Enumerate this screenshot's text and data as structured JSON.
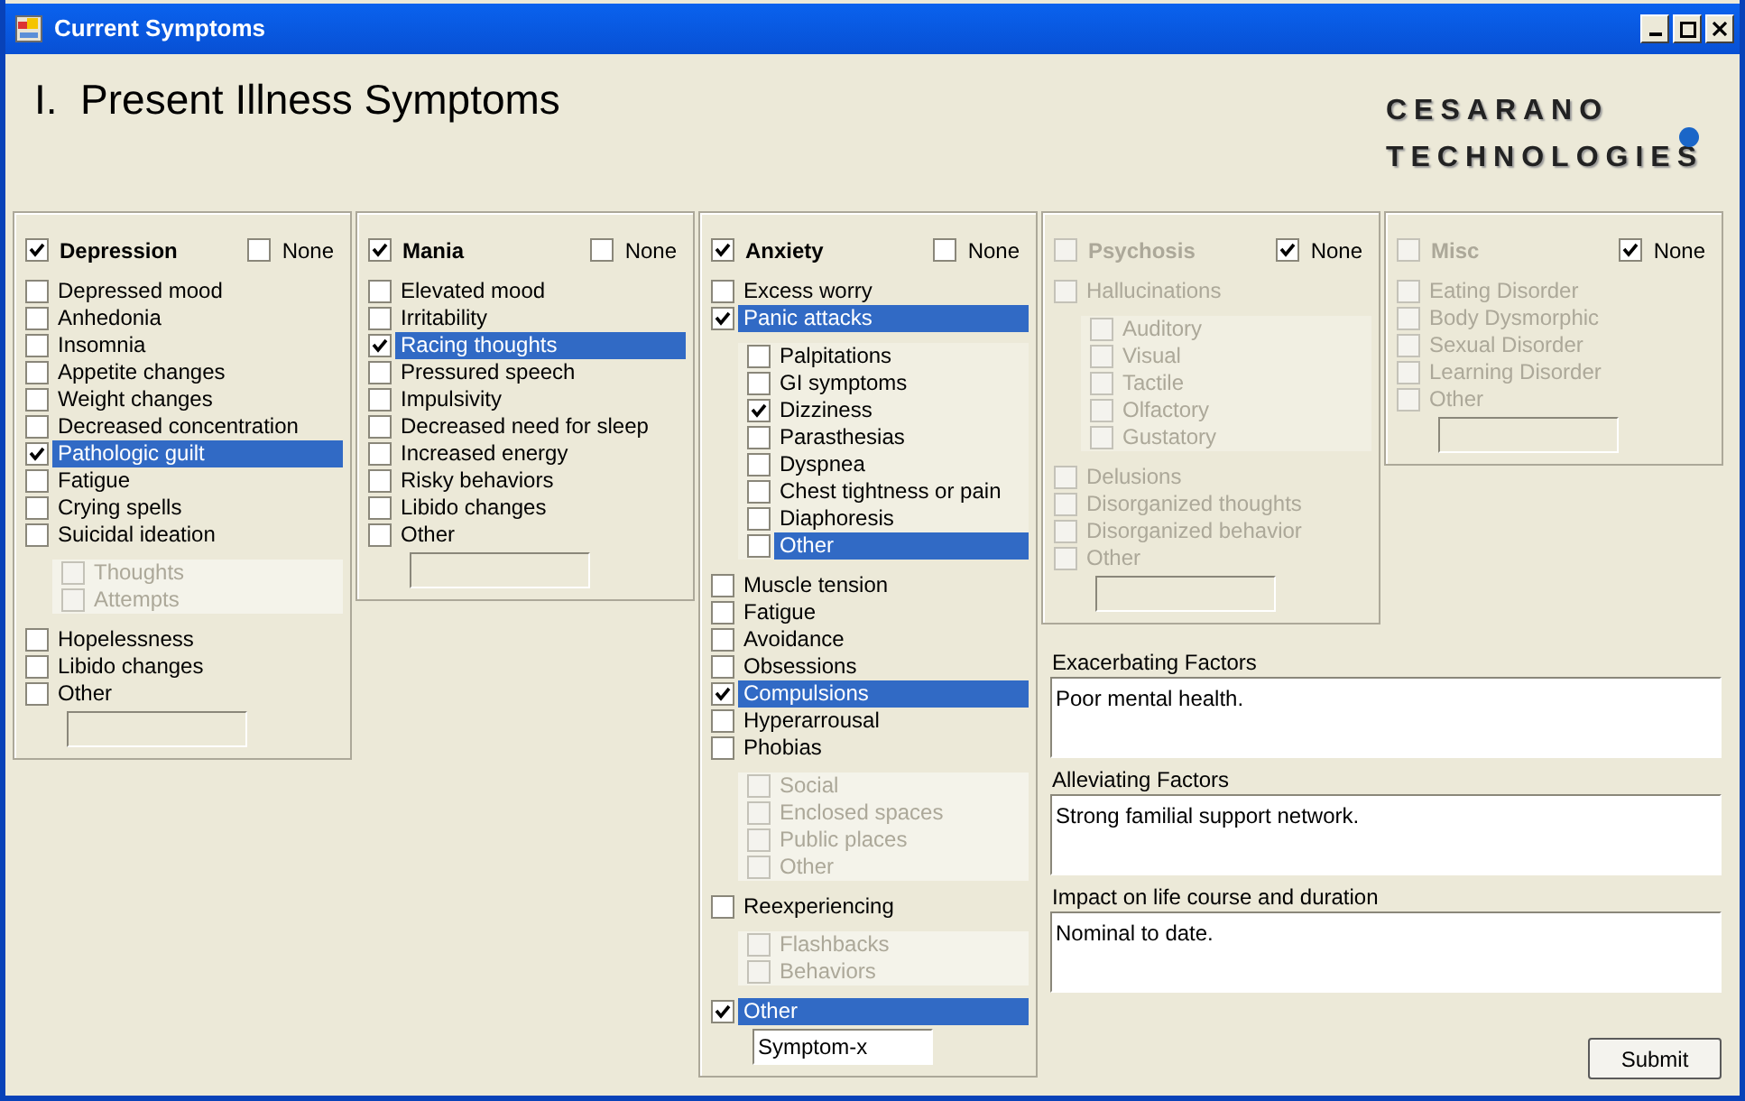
{
  "window": {
    "title": "Current Symptoms"
  },
  "heading": "I.  Present Illness Symptoms",
  "logo": [
    "CESARANO",
    "TECHNOLOGIES"
  ],
  "panels": [
    {
      "title": "Depression",
      "checked": true,
      "disabled": false,
      "none_label": "None",
      "none": false,
      "items": [
        {
          "kind": "check",
          "label": "Depressed mood",
          "checked": false,
          "selected": false
        },
        {
          "kind": "check",
          "label": "Anhedonia",
          "checked": false,
          "selected": false
        },
        {
          "kind": "check",
          "label": "Insomnia",
          "checked": false,
          "selected": false
        },
        {
          "kind": "check",
          "label": "Appetite changes",
          "checked": false,
          "selected": false
        },
        {
          "kind": "check",
          "label": "Weight changes",
          "checked": false,
          "selected": false
        },
        {
          "kind": "check",
          "label": "Decreased concentration",
          "checked": false,
          "selected": false
        },
        {
          "kind": "check",
          "label": "Pathologic guilt",
          "checked": true,
          "selected": true
        },
        {
          "kind": "check",
          "label": "Fatigue",
          "checked": false,
          "selected": false
        },
        {
          "kind": "check",
          "label": "Crying spells",
          "checked": false,
          "selected": false
        },
        {
          "kind": "check",
          "label": "Suicidal ideation",
          "checked": false,
          "selected": false
        },
        {
          "kind": "group",
          "disabled": true,
          "items": [
            {
              "label": "Thoughts",
              "checked": false,
              "selected": false
            },
            {
              "label": "Attempts",
              "checked": false,
              "selected": false
            }
          ]
        },
        {
          "kind": "check",
          "label": "Hopelessness",
          "checked": false,
          "selected": false
        },
        {
          "kind": "check",
          "label": "Libido changes",
          "checked": false,
          "selected": false
        },
        {
          "kind": "check",
          "label": "Other",
          "checked": false,
          "selected": false
        },
        {
          "kind": "field",
          "disabled": true
        }
      ]
    },
    {
      "title": "Mania",
      "checked": true,
      "disabled": false,
      "none_label": "None",
      "none": false,
      "items": [
        {
          "kind": "check",
          "label": "Elevated mood",
          "checked": false,
          "selected": false
        },
        {
          "kind": "check",
          "label": "Irritability",
          "checked": false,
          "selected": false
        },
        {
          "kind": "check",
          "label": "Racing thoughts",
          "checked": true,
          "selected": true
        },
        {
          "kind": "check",
          "label": "Pressured speech",
          "checked": false,
          "selected": false
        },
        {
          "kind": "check",
          "label": "Impulsivity",
          "checked": false,
          "selected": false
        },
        {
          "kind": "check",
          "label": "Decreased need for sleep",
          "checked": false,
          "selected": false
        },
        {
          "kind": "check",
          "label": "Increased energy",
          "checked": false,
          "selected": false
        },
        {
          "kind": "check",
          "label": "Risky behaviors",
          "checked": false,
          "selected": false
        },
        {
          "kind": "check",
          "label": "Libido changes",
          "checked": false,
          "selected": false
        },
        {
          "kind": "check",
          "label": "Other",
          "checked": false,
          "selected": false
        },
        {
          "kind": "field",
          "disabled": true
        }
      ]
    },
    {
      "title": "Anxiety",
      "checked": true,
      "disabled": false,
      "none_label": "None",
      "none": false,
      "items": [
        {
          "kind": "check",
          "label": "Excess worry",
          "checked": false,
          "selected": false
        },
        {
          "kind": "check",
          "label": "Panic attacks",
          "checked": true,
          "selected": true
        },
        {
          "kind": "group",
          "disabled": false,
          "items": [
            {
              "label": "Palpitations",
              "checked": false,
              "selected": false
            },
            {
              "label": "GI symptoms",
              "checked": false,
              "selected": false
            },
            {
              "label": "Dizziness",
              "checked": true,
              "selected": false
            },
            {
              "label": "Parasthesias",
              "checked": false,
              "selected": false
            },
            {
              "label": "Dyspnea",
              "checked": false,
              "selected": false
            },
            {
              "label": "Chest tightness or pain",
              "checked": false,
              "selected": false
            },
            {
              "label": "Diaphoresis",
              "checked": false,
              "selected": false
            },
            {
              "label": "Other",
              "checked": false,
              "selected": true
            }
          ]
        },
        {
          "kind": "check",
          "label": "Muscle tension",
          "checked": false,
          "selected": false
        },
        {
          "kind": "check",
          "label": "Fatigue",
          "checked": false,
          "selected": false
        },
        {
          "kind": "check",
          "label": "Avoidance",
          "checked": false,
          "selected": false
        },
        {
          "kind": "check",
          "label": "Obsessions",
          "checked": false,
          "selected": false
        },
        {
          "kind": "check",
          "label": "Compulsions",
          "checked": true,
          "selected": true
        },
        {
          "kind": "check",
          "label": "Hyperarrousal",
          "checked": false,
          "selected": false
        },
        {
          "kind": "check",
          "label": "Phobias",
          "checked": false,
          "selected": false
        },
        {
          "kind": "group",
          "disabled": true,
          "items": [
            {
              "label": "Social",
              "checked": false,
              "selected": false
            },
            {
              "label": "Enclosed spaces",
              "checked": false,
              "selected": false
            },
            {
              "label": "Public places",
              "checked": false,
              "selected": false
            },
            {
              "label": "Other",
              "checked": false,
              "selected": false
            }
          ]
        },
        {
          "kind": "check",
          "label": "Reexperiencing",
          "checked": false,
          "selected": false
        },
        {
          "kind": "group",
          "disabled": true,
          "items": [
            {
              "label": "Flashbacks",
              "checked": false,
              "selected": false
            },
            {
              "label": "Behaviors",
              "checked": false,
              "selected": false
            }
          ]
        },
        {
          "kind": "check",
          "label": "Other",
          "checked": true,
          "selected": true
        },
        {
          "kind": "field",
          "disabled": false,
          "value": "Symptom-x"
        }
      ]
    },
    {
      "title": "Psychosis",
      "checked": false,
      "disabled": true,
      "none_label": "None",
      "none": true,
      "items": [
        {
          "kind": "check",
          "label": "Hallucinations",
          "checked": false,
          "selected": false
        },
        {
          "kind": "group",
          "items": [
            {
              "label": "Auditory",
              "checked": false,
              "selected": false
            },
            {
              "label": "Visual",
              "checked": false,
              "selected": false
            },
            {
              "label": "Tactile",
              "checked": false,
              "selected": false
            },
            {
              "label": "Olfactory",
              "checked": false,
              "selected": false
            },
            {
              "label": "Gustatory",
              "checked": false,
              "selected": false
            }
          ]
        },
        {
          "kind": "check",
          "label": "Delusions",
          "checked": false,
          "selected": false
        },
        {
          "kind": "check",
          "label": "Disorganized thoughts",
          "checked": false,
          "selected": false
        },
        {
          "kind": "check",
          "label": "Disorganized behavior",
          "checked": false,
          "selected": false
        },
        {
          "kind": "check",
          "label": "Other",
          "checked": false,
          "selected": false
        },
        {
          "kind": "field",
          "disabled": true
        }
      ]
    },
    {
      "title": "Misc",
      "checked": false,
      "disabled": true,
      "none_label": "None",
      "none": true,
      "items": [
        {
          "kind": "check",
          "label": "Eating Disorder",
          "checked": false,
          "selected": false
        },
        {
          "kind": "check",
          "label": "Body Dysmorphic",
          "checked": false,
          "selected": false
        },
        {
          "kind": "check",
          "label": "Sexual Disorder",
          "checked": false,
          "selected": false
        },
        {
          "kind": "check",
          "label": "Learning Disorder",
          "checked": false,
          "selected": false
        },
        {
          "kind": "check",
          "label": "Other",
          "checked": false,
          "selected": false
        },
        {
          "kind": "field",
          "disabled": true
        }
      ]
    }
  ],
  "notes": [
    {
      "label": "Exacerbating Factors",
      "value": "Poor mental health."
    },
    {
      "label": "Alleviating Factors",
      "value": "Strong familial support network."
    },
    {
      "label": "Impact on life course and duration",
      "value": "Nominal to date."
    }
  ],
  "submit": "Submit"
}
